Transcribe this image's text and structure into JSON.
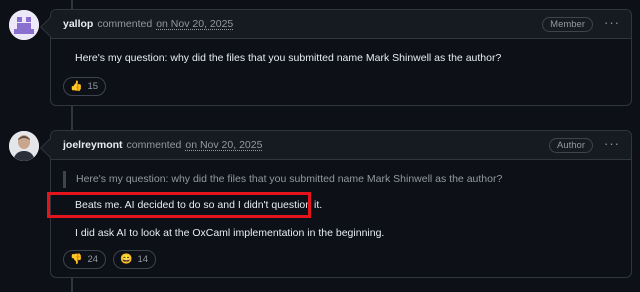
{
  "comments": [
    {
      "author": "yallop",
      "action": "commented",
      "date": "on Nov 20, 2025",
      "role": "Member",
      "more": "···",
      "lines": [
        "Here's my question: why did the files that you submitted name Mark Shinwell as the author?"
      ],
      "reactions": [
        {
          "emoji": "👍",
          "icon": "thumbs-up-icon",
          "count": "15"
        }
      ]
    },
    {
      "author": "joelreymont",
      "action": "commented",
      "date": "on Nov 20, 2025",
      "role": "Author",
      "more": "···",
      "quote": "Here's my question: why did the files that you submitted name Mark Shinwell as the author?",
      "lines": [
        "Beats me. AI decided to do so and I didn't question it.",
        "I did ask AI to look at the OxCaml implementation in the beginning."
      ],
      "reactions": [
        {
          "emoji": "👎",
          "icon": "thumbs-down-icon",
          "count": "24"
        },
        {
          "emoji": "😄",
          "icon": "laugh-icon",
          "count": "14"
        }
      ]
    }
  ],
  "colors": {
    "highlight": "#e3141b",
    "background": "#0d1117",
    "header": "#161b22"
  }
}
